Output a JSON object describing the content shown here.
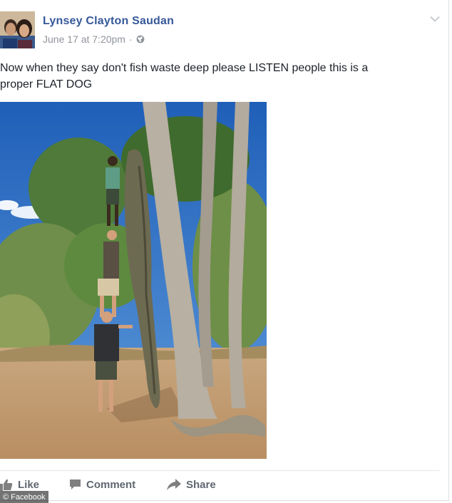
{
  "post": {
    "author": "Lynsey Clayton Saudan",
    "timestamp": "June 17 at 7:20pm",
    "separator": "·",
    "privacy_icon": "globe-icon",
    "menu_icon": "chevron-down-icon",
    "text_line1": "Now when they say don't fish waste deep please LISTEN people this is a",
    "text_line2": "proper FLAT DOG"
  },
  "actions": {
    "like": "Like",
    "comment": "Comment",
    "share": "Share"
  },
  "watermark": "© Facebook",
  "colors": {
    "author_link": "#365899",
    "meta_text": "#90949c",
    "action_text": "#606770",
    "sky": "#2f6fc4"
  }
}
